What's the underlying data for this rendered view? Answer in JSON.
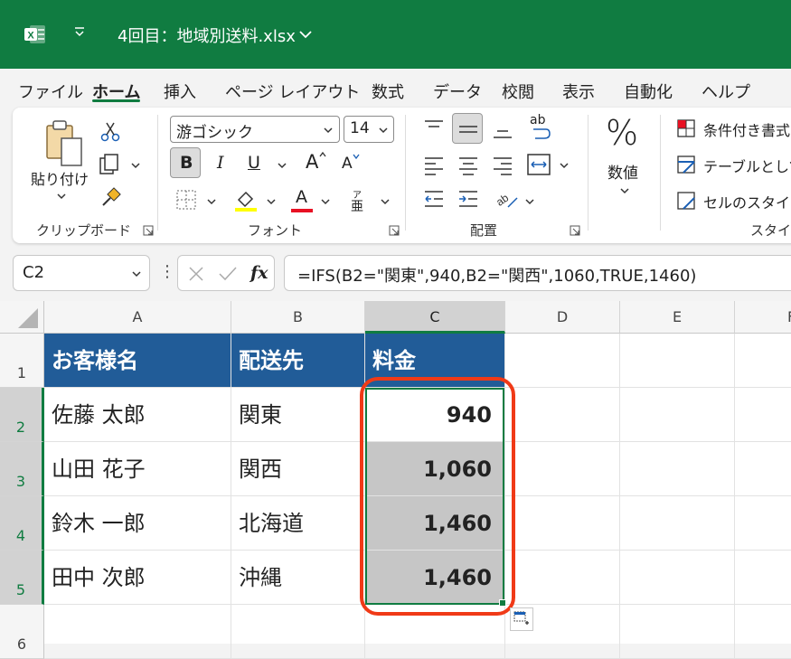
{
  "app": {
    "filename": "4回目：地域別送料.xlsx",
    "quick_access_icon": "chevron-down-icon",
    "brand_color": "#107c41"
  },
  "menu": {
    "tabs": [
      "ファイル",
      "ホーム",
      "挿入",
      "ページ レイアウト",
      "数式",
      "データ",
      "校閲",
      "表示",
      "自動化",
      "ヘルプ"
    ],
    "active": "ホーム"
  },
  "ribbon": {
    "clipboard": {
      "paste_label": "貼り付け",
      "group_label": "クリップボード"
    },
    "font": {
      "font_name": "游ゴシック",
      "font_size": "14",
      "bold": "B",
      "italic": "I",
      "underline": "U",
      "grow": "A",
      "shrink": "A",
      "font_color_letter": "A",
      "phonetic_top": "ア",
      "phonetic_bottom": "亜",
      "group_label": "フォント"
    },
    "alignment": {
      "wrap_label": "ab",
      "group_label": "配置"
    },
    "number": {
      "percent": "%",
      "label": "数値"
    },
    "styles": {
      "conditional": "条件付き書式",
      "as_table": "テーブルとして",
      "cell_styles": "セルのスタイル",
      "group_label": "スタイル"
    }
  },
  "formula_bar": {
    "name_box": "C2",
    "dots": "⋮",
    "fx": "fx",
    "formula": "=IFS(B2=\"関東\",940,B2=\"関西\",1060,TRUE,1460)"
  },
  "sheet": {
    "columns": [
      "A",
      "B",
      "C",
      "D",
      "E",
      "F"
    ],
    "rows": [
      "1",
      "2",
      "3",
      "4",
      "5",
      "6"
    ],
    "header_row": [
      "お客様名",
      "配送先",
      "料金"
    ],
    "data": [
      [
        "佐藤 太郎",
        "関東",
        "940"
      ],
      [
        "山田 花子",
        "関西",
        "1,060"
      ],
      [
        "鈴木 一郎",
        "北海道",
        "1,460"
      ],
      [
        "田中 次郎",
        "沖縄",
        "1,460"
      ]
    ],
    "header_fill": "#215c98",
    "highlight_color": "#f03a17"
  }
}
